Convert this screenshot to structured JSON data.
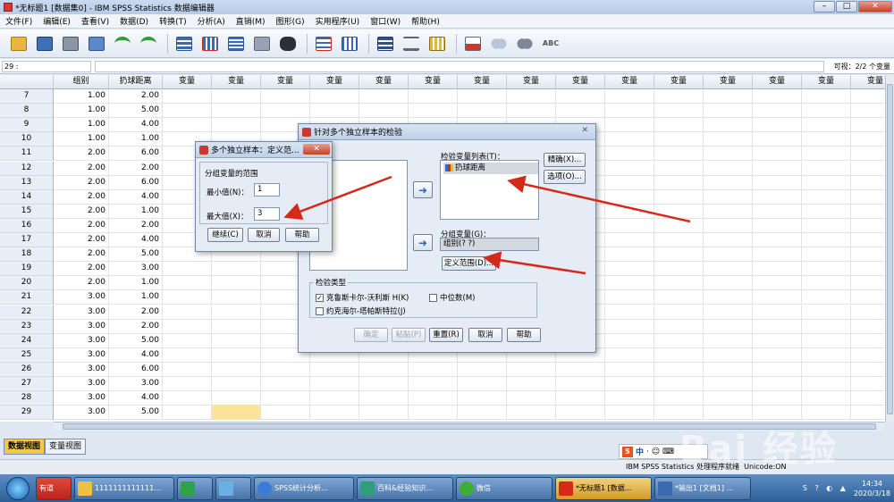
{
  "window": {
    "title": "*无标题1 [数据集0] - IBM SPSS Statistics 数据编辑器",
    "minimize": "–",
    "maximize": "□",
    "close": "✕"
  },
  "menu": [
    "文件(F)",
    "编辑(E)",
    "查看(V)",
    "数据(D)",
    "转换(T)",
    "分析(A)",
    "直销(M)",
    "图形(G)",
    "实用程序(U)",
    "窗口(W)",
    "帮助(H)"
  ],
  "toolbar": {
    "icons": [
      "open-icon",
      "save-icon",
      "print-icon",
      "recall-dialog-icon",
      "undo-icon",
      "redo-icon",
      "goto-case-icon",
      "goto-variable-icon",
      "variables-icon",
      "run-descriptives-icon",
      "find-icon",
      "insert-cases-icon",
      "insert-variable-icon",
      "split-file-icon",
      "weight-cases-icon",
      "select-cases-icon",
      "value-labels-icon",
      "use-sets-icon",
      "show-all-variables-icon",
      "spell-check-icon"
    ],
    "spell_label": "ABC"
  },
  "cellbar": {
    "ref": "29 :",
    "visible": "可视：2/2 个变量"
  },
  "grid": {
    "columns": [
      "组别",
      "扔球距离"
    ],
    "empty_column_label": "变量",
    "empty_column_count": 15,
    "rows": [
      {
        "n": "7",
        "a": "1.00",
        "b": "2.00"
      },
      {
        "n": "8",
        "a": "1.00",
        "b": "5.00"
      },
      {
        "n": "9",
        "a": "1.00",
        "b": "4.00"
      },
      {
        "n": "10",
        "a": "1.00",
        "b": "1.00"
      },
      {
        "n": "11",
        "a": "2.00",
        "b": "6.00"
      },
      {
        "n": "12",
        "a": "2.00",
        "b": "2.00"
      },
      {
        "n": "13",
        "a": "2.00",
        "b": "6.00"
      },
      {
        "n": "14",
        "a": "2.00",
        "b": "4.00"
      },
      {
        "n": "15",
        "a": "2.00",
        "b": "1.00"
      },
      {
        "n": "16",
        "a": "2.00",
        "b": "2.00"
      },
      {
        "n": "17",
        "a": "2.00",
        "b": "4.00"
      },
      {
        "n": "18",
        "a": "2.00",
        "b": "5.00"
      },
      {
        "n": "19",
        "a": "2.00",
        "b": "3.00"
      },
      {
        "n": "20",
        "a": "2.00",
        "b": "1.00"
      },
      {
        "n": "21",
        "a": "3.00",
        "b": "1.00"
      },
      {
        "n": "22",
        "a": "3.00",
        "b": "2.00"
      },
      {
        "n": "23",
        "a": "3.00",
        "b": "2.00"
      },
      {
        "n": "24",
        "a": "3.00",
        "b": "5.00"
      },
      {
        "n": "25",
        "a": "3.00",
        "b": "4.00"
      },
      {
        "n": "26",
        "a": "3.00",
        "b": "6.00"
      },
      {
        "n": "27",
        "a": "3.00",
        "b": "3.00"
      },
      {
        "n": "28",
        "a": "3.00",
        "b": "4.00"
      },
      {
        "n": "29",
        "a": "3.00",
        "b": "5.00"
      }
    ]
  },
  "tabs": {
    "data_view": "数据视图",
    "variable_view": "变量视图"
  },
  "status": {
    "text": "IBM SPSS Statistics 处理程序就绪",
    "unicode": "Unicode:ON"
  },
  "ime": {
    "icon": "S",
    "lang": "中",
    "extra": "· ☺ ⌨"
  },
  "define_range_dialog": {
    "title": "多个独立样本：定义范...",
    "close": "✕",
    "group_label": "分组变量的范围",
    "min_label": "最小值(N)：",
    "min_value": "1",
    "max_label": "最大值(X)：",
    "max_value": "3",
    "continue": "继续(C)",
    "cancel": "取消",
    "help": "帮助"
  },
  "tests_dialog": {
    "title": "针对多个独立样本的检验",
    "close": "✕",
    "test_list_label": "检验变量列表(T)：",
    "test_variable": "扔球距离",
    "exact_btn": "精确(X)...",
    "options_btn": "选项(O)...",
    "group_var_label": "分组变量(G)：",
    "group_var_value": "组别(? ?)",
    "define_range_btn": "定义范围(D)...",
    "test_type_label": "检验类型",
    "kruskal": "克鲁斯卡尔-沃利斯 H(K)",
    "median": "中位数(M)",
    "jonckheere": "约克海尔-塔帕斯特拉(J)",
    "kruskal_checked": true,
    "ok": "确定",
    "paste": "粘贴(P)",
    "reset": "重置(R)",
    "cancel": "取消",
    "help": "帮助"
  },
  "taskbar": {
    "items": [
      "有道",
      "1111111111111...",
      "",
      "",
      "SPSS统计分析...",
      "百科&经验知识...",
      "微信",
      "*无标题1 [数据...",
      "*输出1 [文档1] ..."
    ],
    "time": "14:34",
    "date": "2020/3/18"
  },
  "watermark": "Bai 经验",
  "colors": {
    "accent": "#d42a1a",
    "selected_cell": "#fbe49a",
    "tab_active": "#f4c940"
  }
}
